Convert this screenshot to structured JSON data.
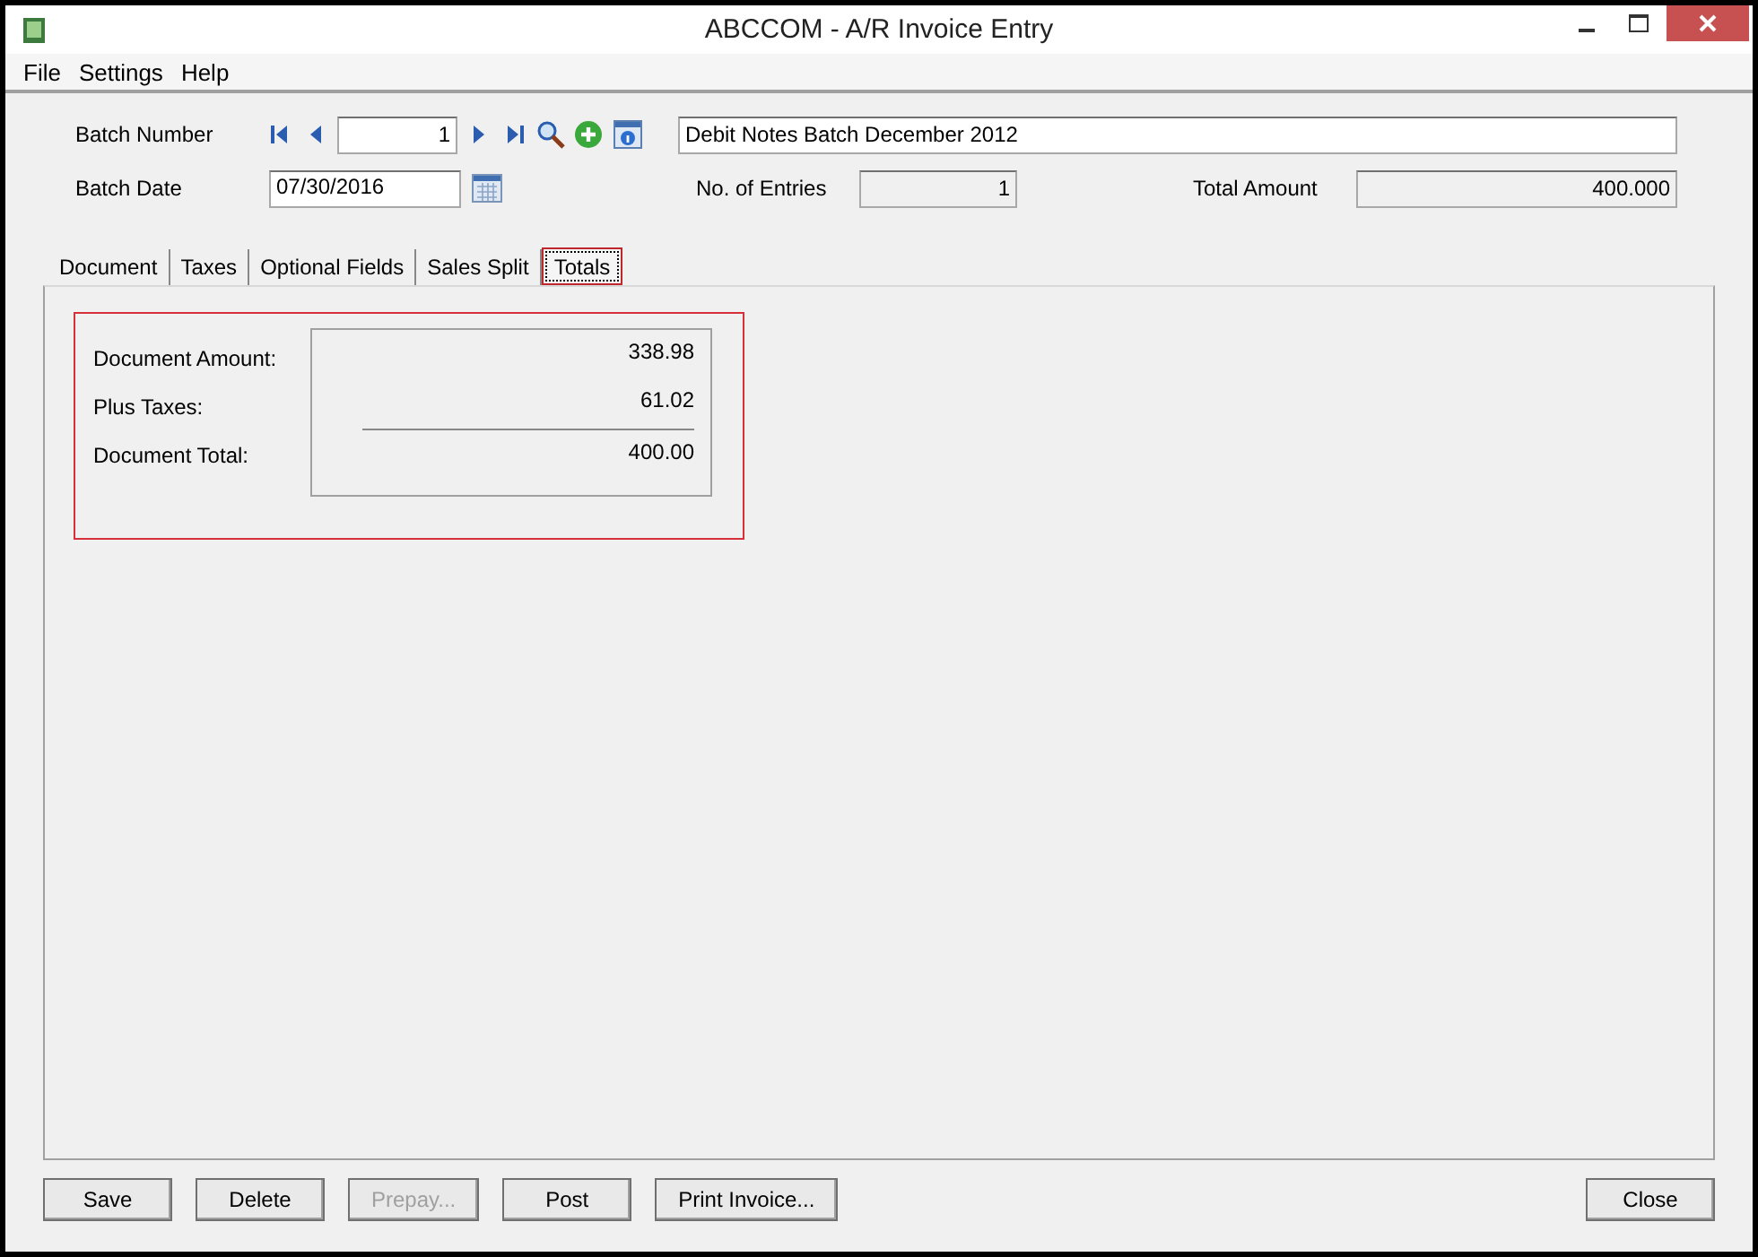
{
  "window": {
    "title": "ABCCOM - A/R Invoice Entry"
  },
  "menu": [
    "File",
    "Settings",
    "Help"
  ],
  "batch": {
    "number_label": "Batch Number",
    "number": "1",
    "description": "Debit Notes Batch December 2012",
    "date_label": "Batch Date",
    "date": "07/30/2016",
    "entries_label": "No. of Entries",
    "entries": "1",
    "total_label": "Total Amount",
    "total": "400.000"
  },
  "tabs": [
    {
      "label": "Document",
      "selected": false
    },
    {
      "label": "Taxes",
      "selected": false
    },
    {
      "label": "Optional Fields",
      "selected": false
    },
    {
      "label": "Sales Split",
      "selected": false
    },
    {
      "label": "Totals",
      "selected": true
    }
  ],
  "totals": [
    {
      "label": "Document Amount:",
      "value": "338.98"
    },
    {
      "label": "Plus Taxes:",
      "value": "61.02"
    },
    {
      "label": "Document Total:",
      "value": "400.00"
    }
  ],
  "buttons": [
    {
      "label": "Save",
      "disabled": false
    },
    {
      "label": "Delete",
      "disabled": false
    },
    {
      "label": "Prepay...",
      "disabled": true
    },
    {
      "label": "Post",
      "disabled": false
    },
    {
      "label": "Print Invoice...",
      "disabled": false
    }
  ],
  "close_button": {
    "label": "Close",
    "disabled": false
  }
}
